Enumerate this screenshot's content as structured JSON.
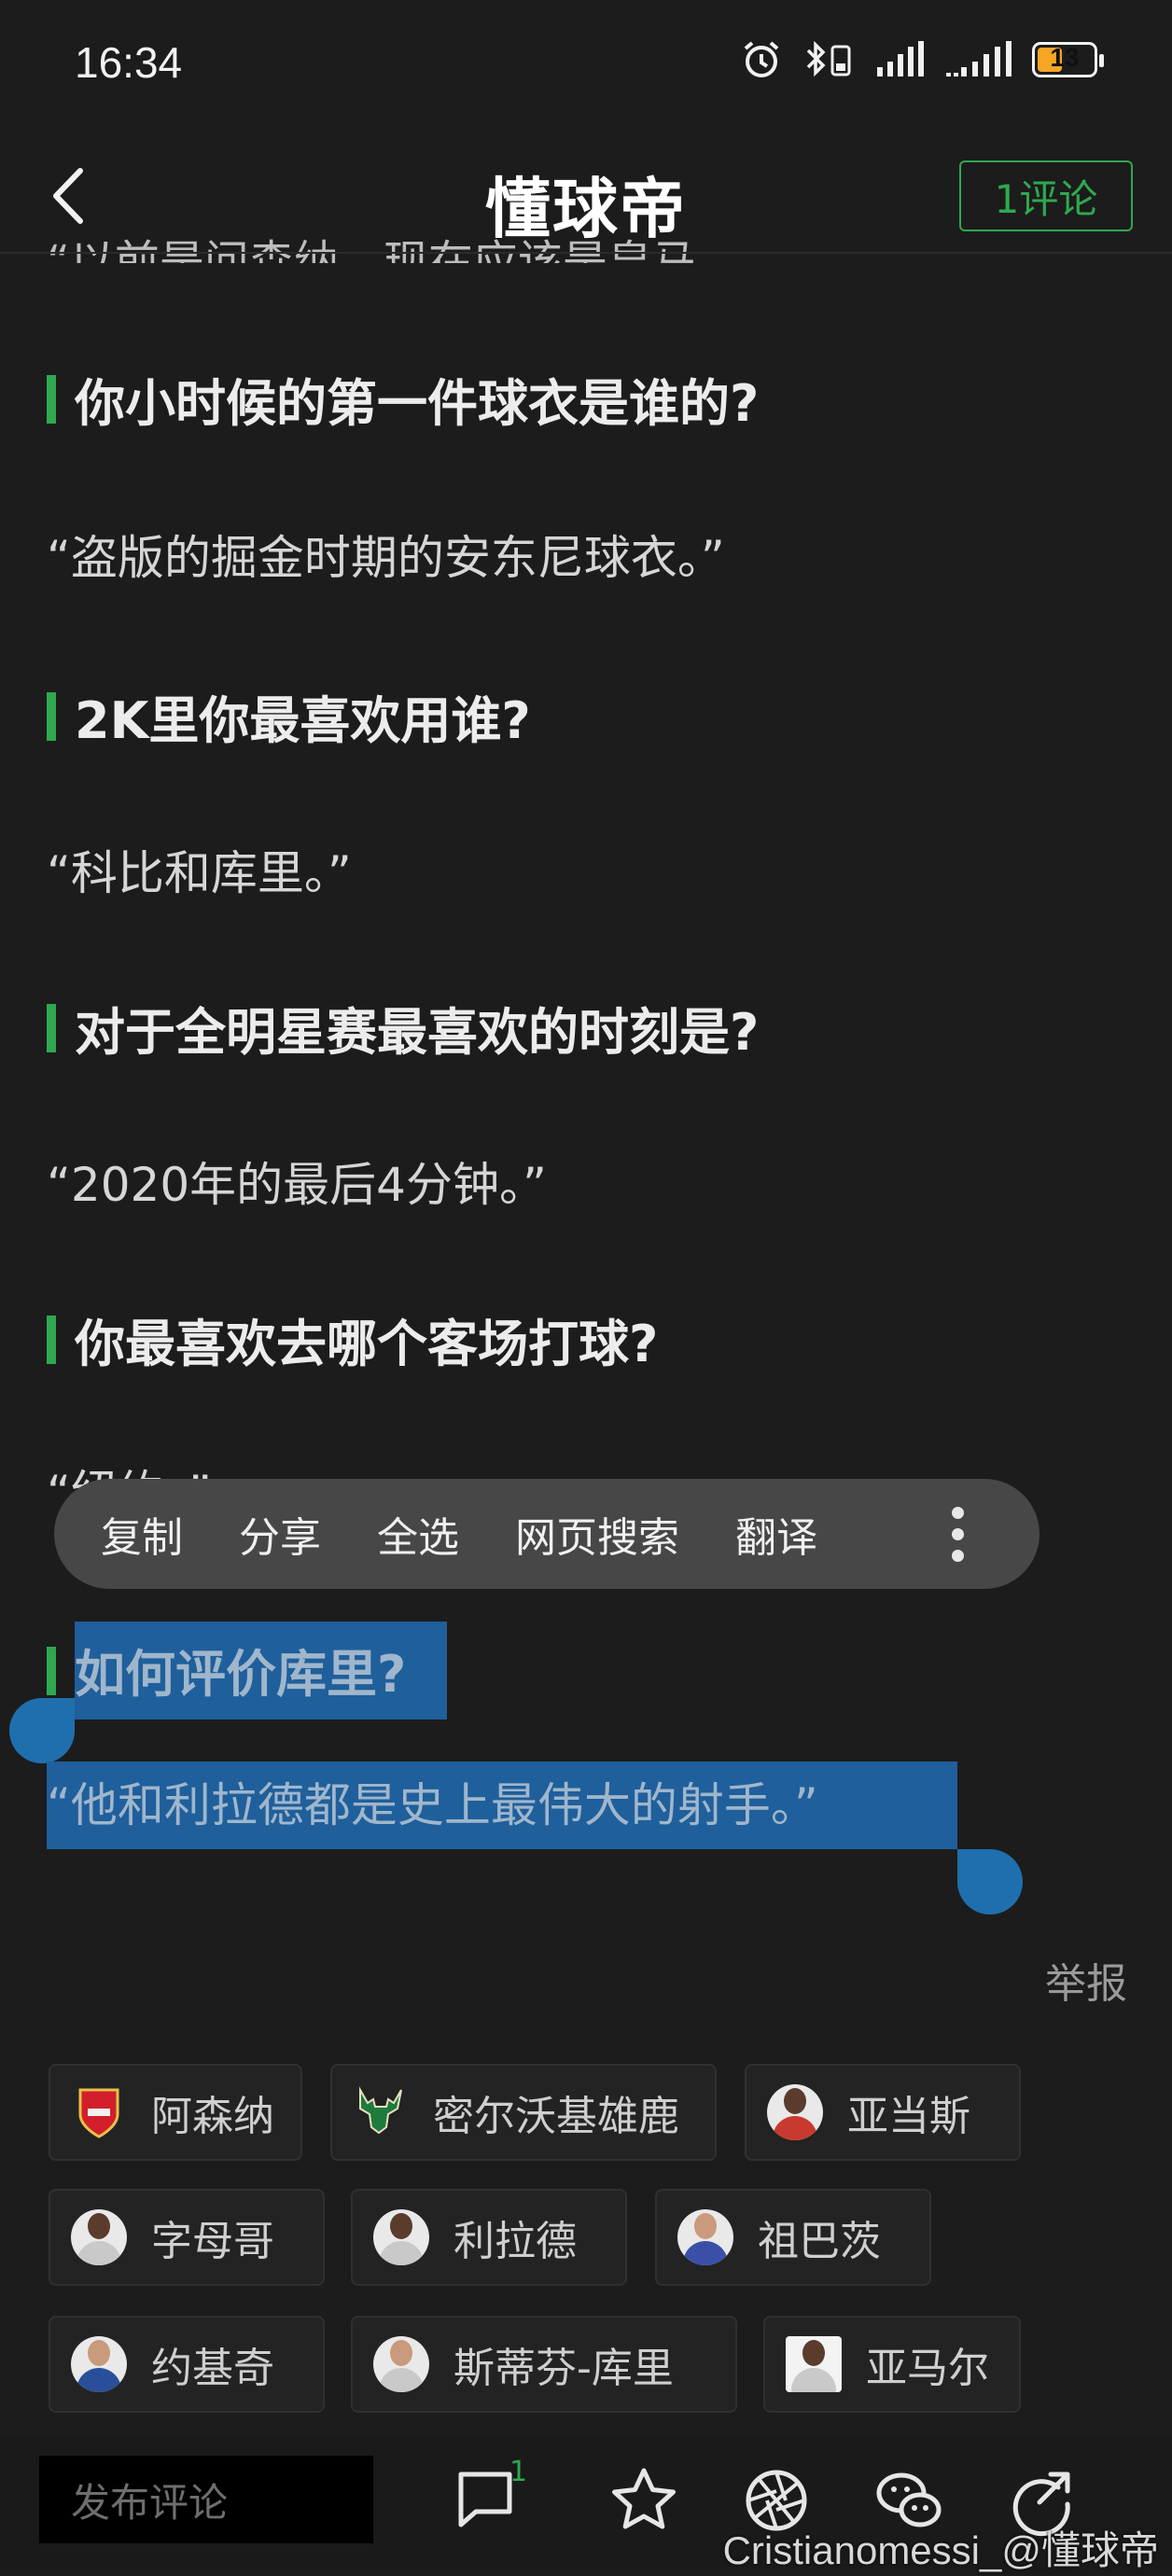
{
  "status_bar": {
    "time": "16:34",
    "battery": "13"
  },
  "header": {
    "title": "懂球帝",
    "comment_button": "1评论"
  },
  "article": {
    "clipped_line": "“以前是问森纳，现在应该是皇马。",
    "qa": [
      {
        "q": "你小时候的第一件球衣是谁的?",
        "a": "“盗版的掘金时期的安东尼球衣。”"
      },
      {
        "q": "2K里你最喜欢用谁?",
        "a": "“科比和库里。”"
      },
      {
        "q": "对于全明星赛最喜欢的时刻是?",
        "a": "“2020年的最后4分钟。”"
      },
      {
        "q": "你最喜欢去哪个客场打球?",
        "a": "“纽约。”"
      },
      {
        "q": "如何评价库里?",
        "a": "“他和利拉德都是史上最伟大的射手。”"
      }
    ],
    "report": "举报"
  },
  "context_menu": {
    "items": [
      "复制",
      "分享",
      "全选",
      "网页搜索",
      "翻译"
    ]
  },
  "tags": [
    {
      "label": "阿森纳",
      "icon": "arsenal-crest-icon"
    },
    {
      "label": "密尔沃基雄鹿",
      "icon": "bucks-logo-icon"
    },
    {
      "label": "亚当斯",
      "icon": "player-avatar"
    },
    {
      "label": "字母哥",
      "icon": "player-avatar"
    },
    {
      "label": "利拉德",
      "icon": "player-avatar"
    },
    {
      "label": "祖巴茨",
      "icon": "player-avatar"
    },
    {
      "label": "约基奇",
      "icon": "player-avatar"
    },
    {
      "label": "斯蒂芬-库里",
      "icon": "player-avatar"
    },
    {
      "label": "亚马尔",
      "icon": "player-avatar"
    }
  ],
  "bottom_bar": {
    "input_placeholder": "发布评论",
    "comment_count": "1",
    "icons": [
      "comment-icon",
      "star-icon",
      "moments-icon",
      "wechat-icon",
      "share-icon"
    ]
  },
  "watermark": "Cristianomessi_@懂球帝",
  "colors": {
    "accent": "#2fa84f",
    "selection": "#1f5f9b",
    "background": "#1c1c1c"
  }
}
